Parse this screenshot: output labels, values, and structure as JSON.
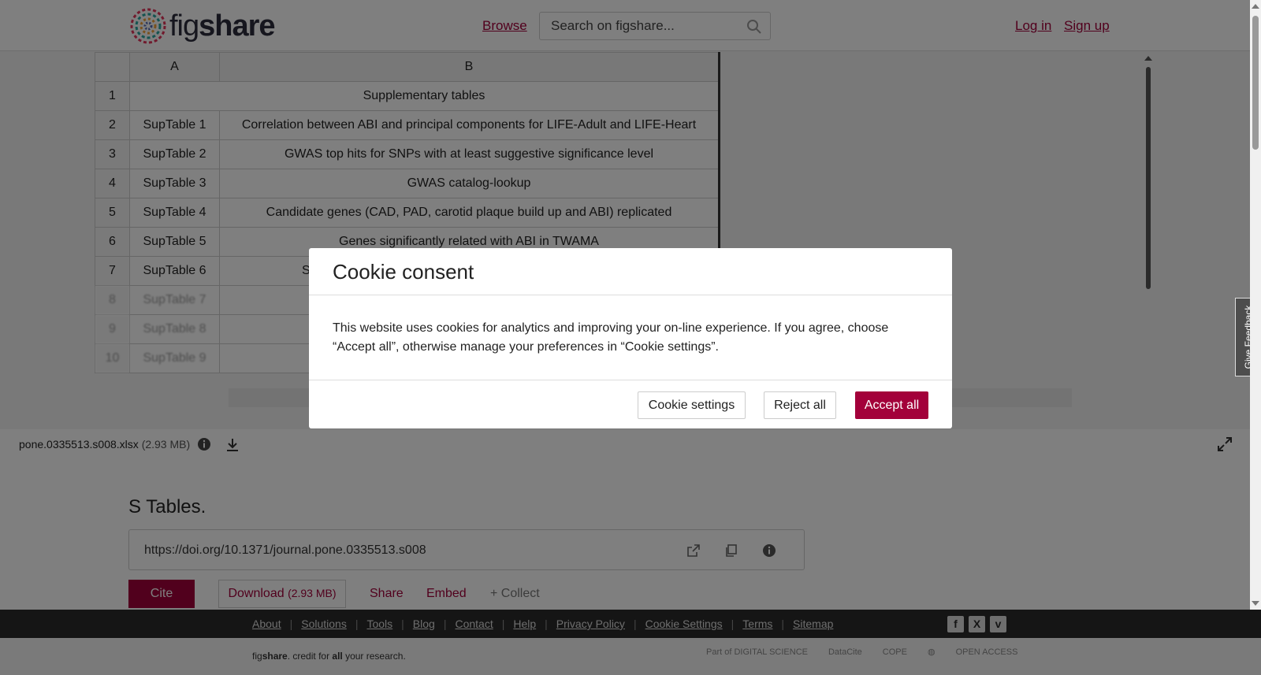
{
  "header": {
    "logo_text_light": "fig",
    "logo_text_bold": "share",
    "browse": "Browse",
    "search_placeholder": "Search on figshare...",
    "login": "Log in",
    "signup": "Sign up"
  },
  "sheet": {
    "col_headers": [
      "A",
      "B"
    ],
    "merged_row": {
      "num": "1",
      "text": "Supplementary tables"
    },
    "rows": [
      {
        "num": "2",
        "a": "SupTable 1",
        "b": "Correlation between ABI and principal components for LIFE-Adult and LIFE-Heart"
      },
      {
        "num": "3",
        "a": "SupTable 2",
        "b": "GWAS top hits for SNPs with at least suggestive significance level"
      },
      {
        "num": "4",
        "a": "SupTable 3",
        "b": "GWAS catalog-lookup"
      },
      {
        "num": "5",
        "a": "SupTable 4",
        "b": "Candidate genes (CAD, PAD, carotid plaque build up and ABI) replicated"
      },
      {
        "num": "6",
        "a": "SupTable 5",
        "b": "Genes significantly related with ABI in TWAMA"
      },
      {
        "num": "7",
        "a": "SupTable 6",
        "b": "S"
      },
      {
        "num": "8",
        "a": "SupTable 7",
        "b": ""
      },
      {
        "num": "9",
        "a": "SupTable 8",
        "b": ""
      },
      {
        "num": "10",
        "a": "SupTable 9",
        "b": ""
      }
    ]
  },
  "file": {
    "name": "pone.0335513.s008.xlsx",
    "size": "(2.93 MB)"
  },
  "item": {
    "title": "S Tables.",
    "doi": "https://doi.org/10.1371/journal.pone.0335513.s008",
    "cite": "Cite",
    "download": "Download",
    "download_size": "(2.93 MB)",
    "share": "Share",
    "embed": "Embed",
    "collect": "+ Collect"
  },
  "footer": {
    "links": [
      "About",
      "Solutions",
      "Tools",
      "Blog",
      "Contact",
      "Help",
      "Privacy Policy",
      "Cookie Settings",
      "Terms",
      "Sitemap"
    ],
    "tagline_light": "fig",
    "tagline_bold": "share",
    "tagline_rest1": ". credit for ",
    "tagline_all": "all",
    "tagline_rest2": " your research.",
    "partners": [
      "Part of DIGITAL SCIENCE",
      "DataCite",
      "COPE",
      "",
      "OPEN ACCESS"
    ]
  },
  "feedback": "Give Feedback",
  "modal": {
    "title": "Cookie consent",
    "body": "This website uses cookies for analytics and improving your on-line experience. If you agree, choose “Accept all”, otherwise manage your preferences in “Cookie settings”.",
    "settings": "Cookie settings",
    "reject": "Reject all",
    "accept": "Accept all"
  },
  "colors": {
    "brand": "#a3003a",
    "footer_bg": "#2a2a2a"
  }
}
